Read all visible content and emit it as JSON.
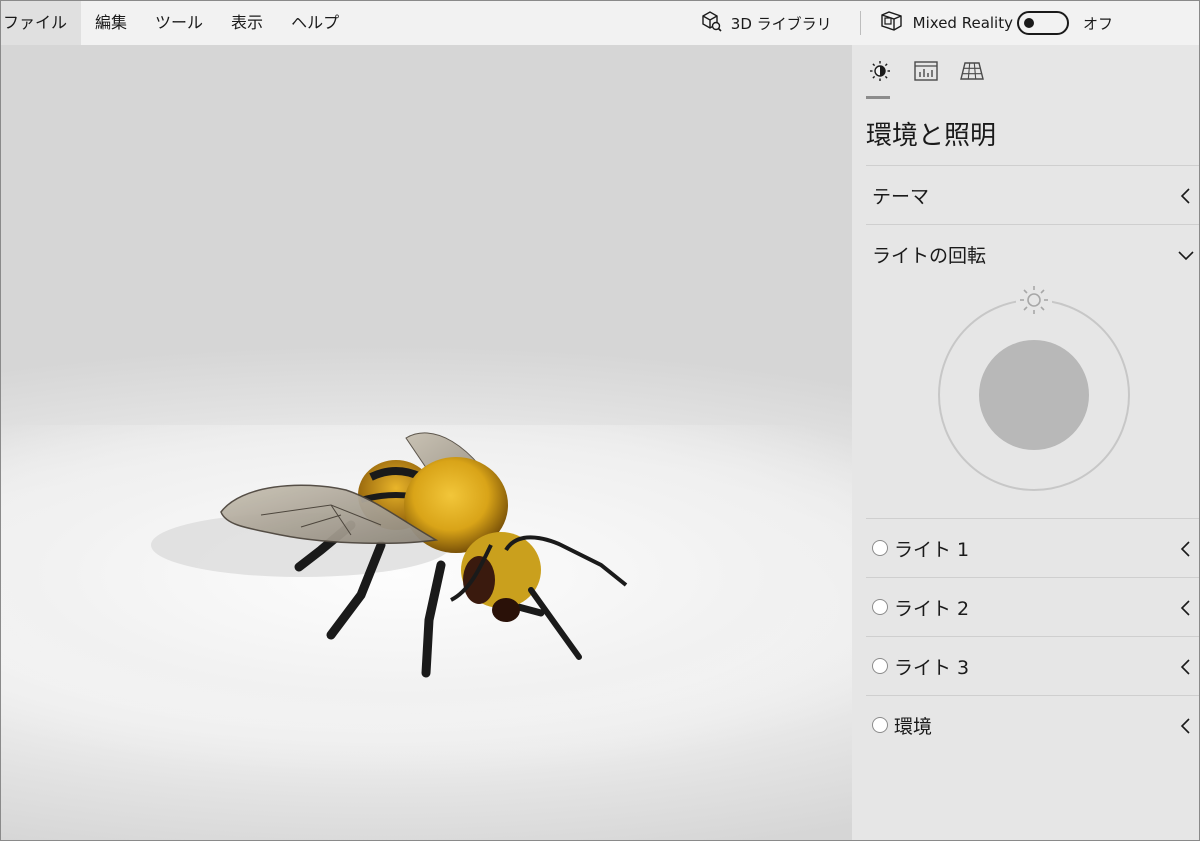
{
  "menu": {
    "items": [
      "ファイル",
      "編集",
      "ツール",
      "表示",
      "ヘルプ"
    ]
  },
  "toolbar": {
    "library_label": "3D ライブラリ",
    "mixed_reality_label": "Mixed Reality",
    "toggle_state_label": "オフ"
  },
  "panel": {
    "title": "環境と照明",
    "tabs": [
      "lighting-icon",
      "stats-icon",
      "grid-icon"
    ],
    "theme_label": "テーマ",
    "rotation_label": "ライトの回転",
    "lights": [
      {
        "label": "ライト 1"
      },
      {
        "label": "ライト 2"
      },
      {
        "label": "ライト 3"
      },
      {
        "label": "環境"
      }
    ]
  },
  "colors": {
    "menubar_bg": "#f2f2f2",
    "panel_bg": "#e6e6e6",
    "dial_fill": "#b8b8b8",
    "bee_yellow": "#d9a418"
  }
}
